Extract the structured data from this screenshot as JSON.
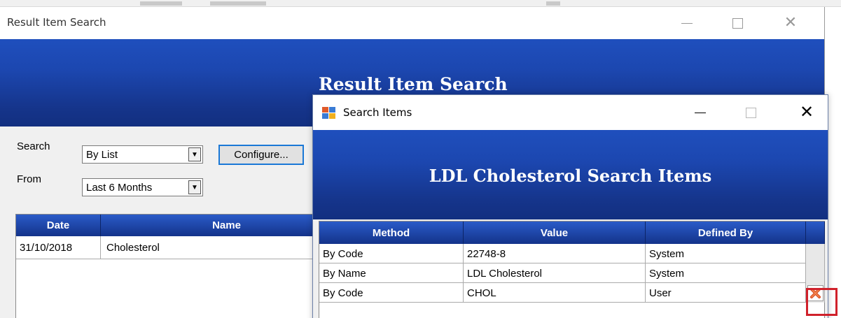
{
  "main_window": {
    "title": "Result Item Search",
    "banner_title": "Result Item Search",
    "search_label": "Search",
    "search_value": "By List",
    "configure_label": "Configure...",
    "from_label": "From",
    "from_value": "Last 6 Months",
    "grid": {
      "columns": [
        "Date",
        "Name"
      ],
      "rows": [
        {
          "date": "31/10/2018",
          "name": "Cholesterol"
        }
      ]
    }
  },
  "dialog": {
    "title": "Search Items",
    "banner_title": "LDL Cholesterol Search Items",
    "grid": {
      "columns": [
        "Method",
        "Value",
        "Defined By"
      ],
      "rows": [
        {
          "method": "By Code",
          "value": "22748-8",
          "defined_by": "System"
        },
        {
          "method": "By Name",
          "value": "LDL Cholesterol",
          "defined_by": "System"
        },
        {
          "method": "By Code",
          "value": "CHOL",
          "defined_by": "User"
        }
      ]
    }
  },
  "colors": {
    "banner_blue": "#1c47b0",
    "highlight_red": "#d0212b",
    "focus_blue": "#1a78d6"
  },
  "icons": {
    "delete": "red-x-delete-icon",
    "app": "window-app-icon"
  }
}
